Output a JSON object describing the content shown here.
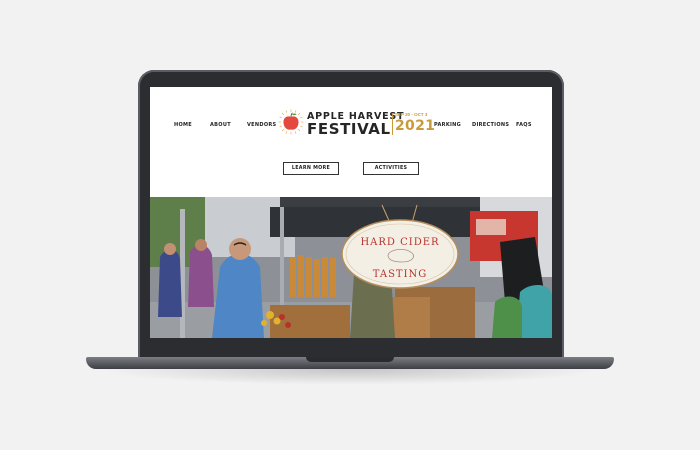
{
  "site": {
    "nav_left": [
      "HOME",
      "ABOUT",
      "VENDORS"
    ],
    "nav_right": [
      "PARKING",
      "DIRECTIONS",
      "FAQS"
    ],
    "logo": {
      "line1": "APPLE HARVEST",
      "line2": "FESTIVAL",
      "dates": "SEP 30 - OCT 3",
      "year": "2021"
    },
    "buttons": {
      "learn_more": "LEARN MORE",
      "activities": "ACTIVITIES"
    },
    "hero": {
      "sign_line1": "HARD CIDER",
      "sign_line2": "TASTING"
    }
  },
  "colors": {
    "accent_gold": "#c99a3a",
    "apple_red": "#e5483c",
    "bezel": "#2b2d31",
    "background": "#f2f2f2"
  },
  "icons": {
    "logo": "apple-icon"
  }
}
